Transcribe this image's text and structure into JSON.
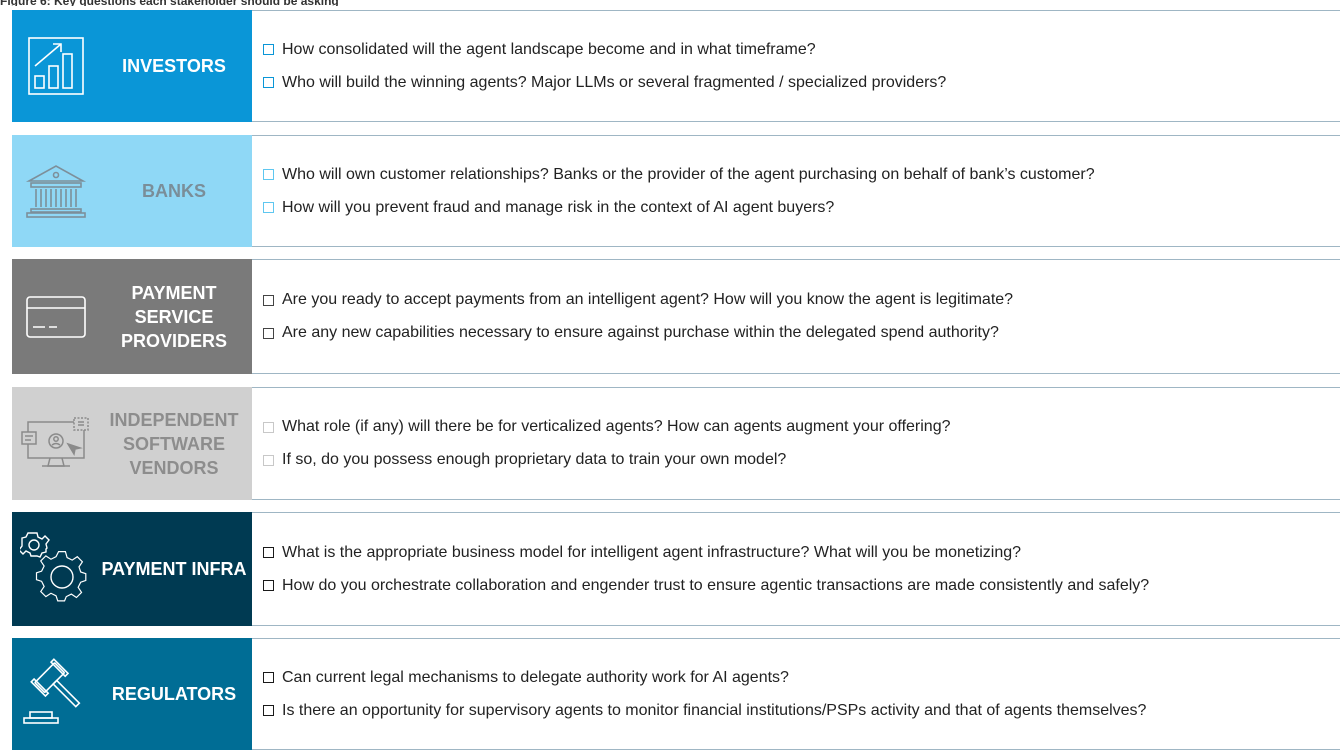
{
  "header": {
    "title": "Figure 6: Key questions each stakeholder should be asking"
  },
  "colors": {
    "investors": "#0a96d7",
    "banks": "#8fd8f6",
    "payment_service_providers": "#7a7a7a",
    "independent_software_vendors": "#d0d0d0",
    "payment_infra": "#003a52",
    "regulators": "#006d95",
    "rule_line": "#9fb6c4"
  },
  "rows": [
    {
      "key": "investors",
      "label": "INVESTORS",
      "icon": "bar-chart-growth-icon",
      "checkbox_color": "#0a96d7",
      "questions": [
        "How consolidated will the agent landscape become and in what timeframe?",
        "Who will build the winning agents? Major LLMs or several fragmented / specialized providers?"
      ]
    },
    {
      "key": "banks",
      "label": "BANKS",
      "icon": "bank-building-icon",
      "checkbox_color": "#5ec7f0",
      "questions": [
        "Who will own customer relationships? Banks or the provider of the agent purchasing on behalf of bank’s customer?",
        "How will you prevent fraud and manage risk in the context of AI agent buyers?"
      ]
    },
    {
      "key": "payment_service_providers",
      "label": "PAYMENT SERVICE PROVIDERS",
      "icon": "credit-card-icon",
      "checkbox_color": "#444444",
      "questions": [
        "Are you ready to accept payments from an intelligent agent? How will you know the agent is legitimate?",
        "Are any new capabilities necessary to ensure against purchase within the delegated spend authority?"
      ]
    },
    {
      "key": "independent_software_vendors",
      "label": "INDEPENDENT SOFTWARE VENDORS",
      "icon": "software-monitor-icon",
      "checkbox_color": "#c8c8c8",
      "questions": [
        "What role (if any) will there be for verticalized agents? How can agents augment your offering?",
        "If so, do you possess enough proprietary data to train your own model?"
      ]
    },
    {
      "key": "payment_infra",
      "label": "PAYMENT INFRA",
      "icon": "gears-icon",
      "checkbox_color": "#1a1a1a",
      "questions": [
        "What is the appropriate business model for intelligent agent infrastructure? What will you be monetizing?",
        "How do you orchestrate collaboration and engender trust to ensure agentic transactions are made consistently and safely?"
      ]
    },
    {
      "key": "regulators",
      "label": "REGULATORS",
      "icon": "gavel-icon",
      "checkbox_color": "#1a1a1a",
      "questions": [
        "Can current legal mechanisms to delegate authority work for AI agents?",
        "Is there an opportunity for supervisory agents to monitor financial institutions/PSPs activity and that of agents themselves?"
      ]
    }
  ]
}
